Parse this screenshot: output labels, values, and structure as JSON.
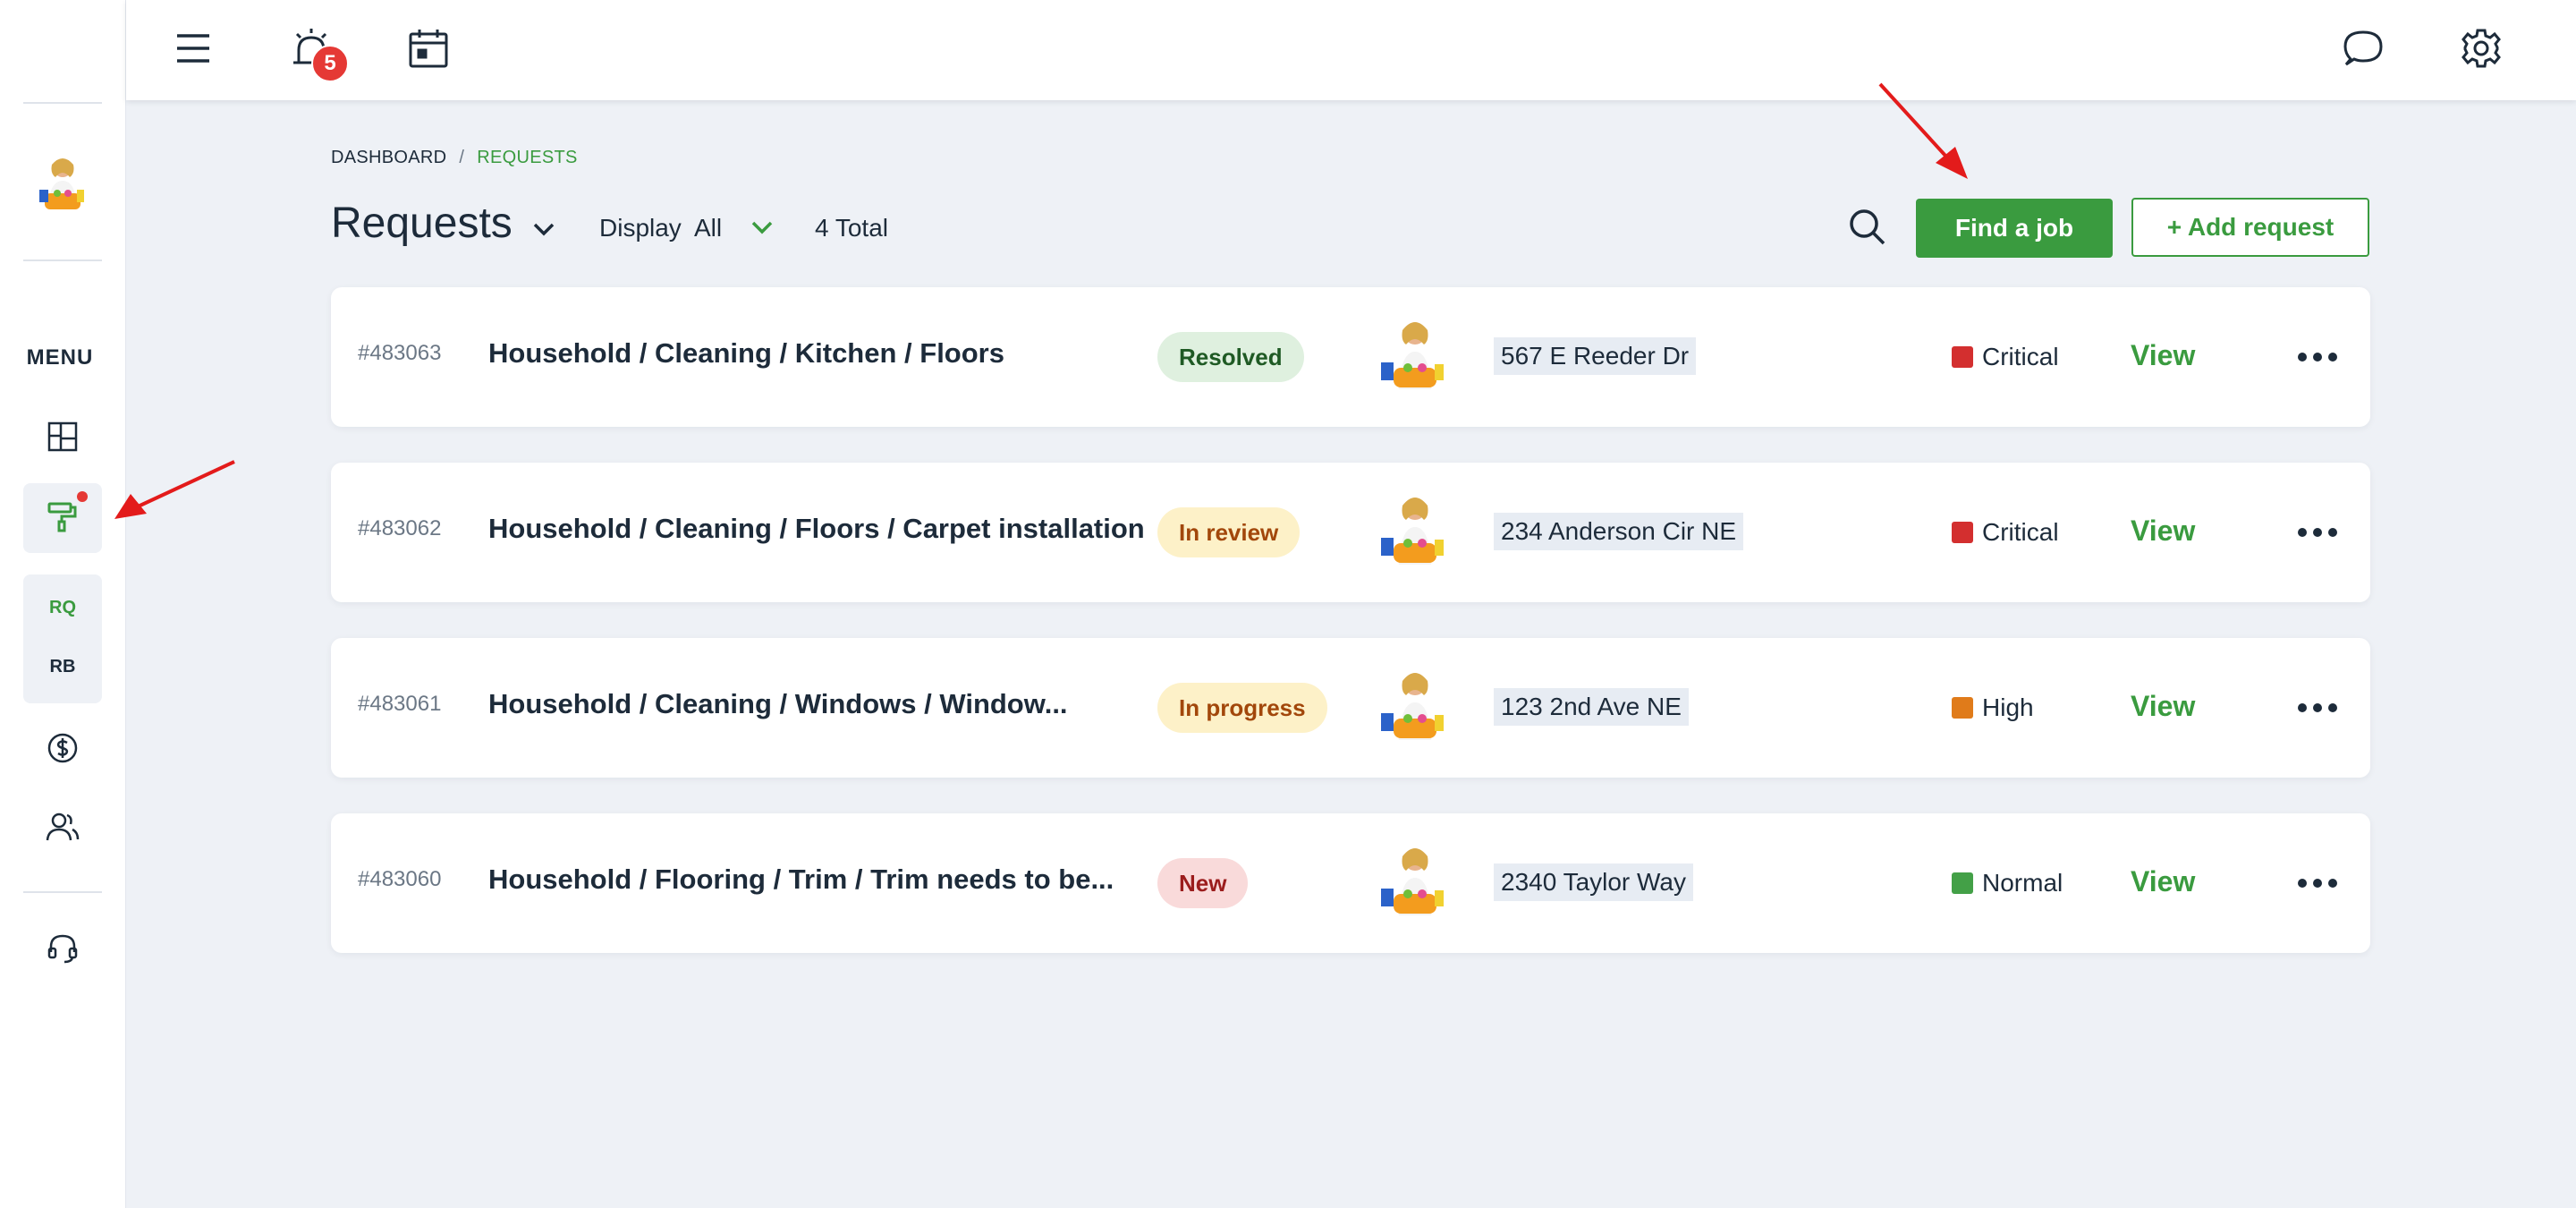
{
  "sidebar": {
    "menu_label": "MENU",
    "sub_items": [
      "RQ",
      "RB"
    ],
    "icons": [
      "dashboard-icon",
      "paint-roller-icon",
      "dollar-icon",
      "users-icon",
      "headset-icon"
    ]
  },
  "topbar": {
    "notifications_count": "5",
    "icons": [
      "menu-icon",
      "alarm-icon",
      "calendar-icon",
      "chat-icon",
      "gear-icon"
    ]
  },
  "breadcrumb": {
    "home": "DASHBOARD",
    "separator": "/",
    "current": "REQUESTS"
  },
  "header": {
    "title": "Requests",
    "display_label": "Display",
    "display_value": "All",
    "total": "4 Total",
    "find_job_label": "Find a job",
    "add_request_label": "+ Add request"
  },
  "requests": [
    {
      "id": "#483063",
      "title": "Household / Cleaning / Kitchen / Floors",
      "status": "Resolved",
      "address": "567 E Reeder Dr",
      "priority": "Critical",
      "view_label": "View"
    },
    {
      "id": "#483062",
      "title": "Household / Cleaning / Floors / Carpet installation",
      "status": "In review",
      "address": "234 Anderson Cir NE",
      "priority": "Critical",
      "view_label": "View"
    },
    {
      "id": "#483061",
      "title": "Household / Cleaning / Windows / Window...",
      "status": "In progress",
      "address": "123 2nd Ave NE",
      "priority": "High",
      "view_label": "View"
    },
    {
      "id": "#483060",
      "title": "Household / Flooring / Trim / Trim needs to be...",
      "status": "New",
      "address": "2340 Taylor Way",
      "priority": "Normal",
      "view_label": "View"
    }
  ],
  "colors": {
    "accent": "#3a9b3f",
    "status_resolved": "#dff0df",
    "status_in_review": "#fdf1c8",
    "status_in_progress": "#fdf1c8",
    "status_new": "#f9dada",
    "priority_critical": "#d32f2f",
    "priority_high": "#e07b1a",
    "priority_normal": "#43a047"
  }
}
